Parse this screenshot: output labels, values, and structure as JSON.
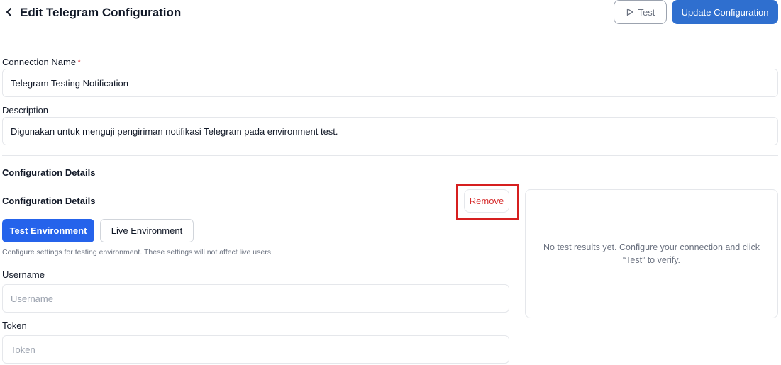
{
  "header": {
    "title": "Edit Telegram Configuration",
    "test_label": "Test",
    "update_label": "Update Configuration"
  },
  "form": {
    "connection_name": {
      "label": "Connection Name",
      "required_mark": "*",
      "value": "Telegram Testing Notification"
    },
    "description": {
      "label": "Description",
      "value": "Digunakan untuk menguji pengiriman notifikasi Telegram pada environment test."
    }
  },
  "config": {
    "section_title": "Configuration Details",
    "subsection_title": "Configuration Details",
    "remove_label": "Remove",
    "env_tabs": [
      "Test Environment",
      "Live Environment"
    ],
    "selected_env": "Test Environment",
    "helper_text": "Configure settings for testing environment. These settings will not affect live users.",
    "username": {
      "label": "Username",
      "placeholder": "Username"
    },
    "token": {
      "label": "Token",
      "placeholder": "Token"
    }
  },
  "results": {
    "empty_text": "No test results yet. Configure your connection and click “Test” to verify."
  },
  "colors": {
    "primary": "#2563eb",
    "update_button": "#2f6fcf",
    "danger": "#d62d2d",
    "highlight": "#d61f1f"
  },
  "icons": {
    "back": "chevron-left-icon",
    "test": "play-icon"
  }
}
